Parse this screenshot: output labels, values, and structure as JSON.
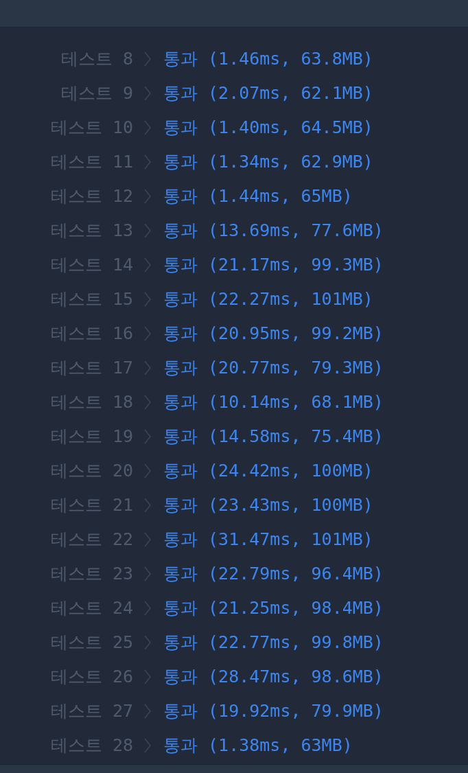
{
  "rows": [
    {
      "label": "테스트 8",
      "result": "통과 (1.46ms, 63.8MB)"
    },
    {
      "label": "테스트 9",
      "result": "통과 (2.07ms, 62.1MB)"
    },
    {
      "label": "테스트 10",
      "result": "통과 (1.40ms, 64.5MB)"
    },
    {
      "label": "테스트 11",
      "result": "통과 (1.34ms, 62.9MB)"
    },
    {
      "label": "테스트 12",
      "result": "통과 (1.44ms, 65MB)"
    },
    {
      "label": "테스트 13",
      "result": "통과 (13.69ms, 77.6MB)"
    },
    {
      "label": "테스트 14",
      "result": "통과 (21.17ms, 99.3MB)"
    },
    {
      "label": "테스트 15",
      "result": "통과 (22.27ms, 101MB)"
    },
    {
      "label": "테스트 16",
      "result": "통과 (20.95ms, 99.2MB)"
    },
    {
      "label": "테스트 17",
      "result": "통과 (20.77ms, 79.3MB)"
    },
    {
      "label": "테스트 18",
      "result": "통과 (10.14ms, 68.1MB)"
    },
    {
      "label": "테스트 19",
      "result": "통과 (14.58ms, 75.4MB)"
    },
    {
      "label": "테스트 20",
      "result": "통과 (24.42ms, 100MB)"
    },
    {
      "label": "테스트 21",
      "result": "통과 (23.43ms, 100MB)"
    },
    {
      "label": "테스트 22",
      "result": "통과 (31.47ms, 101MB)"
    },
    {
      "label": "테스트 23",
      "result": "통과 (22.79ms, 96.4MB)"
    },
    {
      "label": "테스트 24",
      "result": "통과 (21.25ms, 98.4MB)"
    },
    {
      "label": "테스트 25",
      "result": "통과 (22.77ms, 99.8MB)"
    },
    {
      "label": "테스트 26",
      "result": "통과 (28.47ms, 98.6MB)"
    },
    {
      "label": "테스트 27",
      "result": "통과 (19.92ms, 79.9MB)"
    },
    {
      "label": "테스트 28",
      "result": "통과 (1.38ms, 63MB)"
    }
  ]
}
